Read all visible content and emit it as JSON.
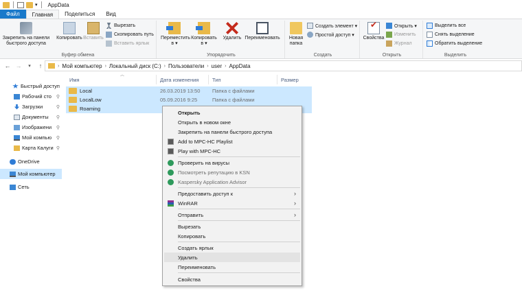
{
  "window": {
    "title": "AppData"
  },
  "tabs": [
    {
      "label": "Файл"
    },
    {
      "label": "Главная"
    },
    {
      "label": "Поделиться"
    },
    {
      "label": "Вид"
    }
  ],
  "ribbon": {
    "clipboard": {
      "pin_label_1": "Закрепить на панели",
      "pin_label_2": "быстрого доступа",
      "copy_label": "Копировать",
      "paste_label": "Вставить",
      "cut_label": "Вырезать",
      "copy_path_label": "Скопировать путь",
      "paste_link_label": "Вставить ярлык",
      "group_label": "Буфер обмена"
    },
    "organize": {
      "move_label": "Переместить",
      "copy_to_label": "Копировать",
      "delete_label": "Удалить",
      "rename_label": "Переименовать",
      "arrow": "в ▾",
      "group_label": "Упорядочить"
    },
    "new": {
      "new_folder_1": "Новая",
      "new_folder_2": "папка",
      "new_item_label": "Создать элемент ▾",
      "easy_access_label": "Простой доступ ▾",
      "group_label": "Создать"
    },
    "open": {
      "properties_label": "Свойства",
      "open_label": "Открыть ▾",
      "edit_label": "Изменить",
      "history_label": "Журнал",
      "group_label": "Открыть"
    },
    "select": {
      "select_all_label": "Выделить все",
      "select_none_label": "Снять выделение",
      "invert_label": "Обратить выделение",
      "group_label": "Выделить"
    }
  },
  "address": {
    "crumbs": [
      "Мой компьютер",
      "Локальный диск (C:)",
      "Пользователи",
      "user",
      "AppData"
    ]
  },
  "nav": {
    "items": [
      {
        "label": "Быстрый доступ",
        "icon": "star-icon"
      },
      {
        "label": "Рабочий сто",
        "icon": "desktop-icon"
      },
      {
        "label": "Загрузки",
        "icon": "download-icon"
      },
      {
        "label": "Документы",
        "icon": "documents-icon"
      },
      {
        "label": "Изображени",
        "icon": "pictures-icon"
      },
      {
        "label": "Мой компью",
        "icon": "computer-icon"
      },
      {
        "label": "Карта Калуги",
        "icon": "folder-icon"
      },
      {
        "label": "OneDrive",
        "icon": "cloud-icon"
      },
      {
        "label": "Мой компьютер",
        "icon": "computer-icon"
      },
      {
        "label": "Сеть",
        "icon": "network-icon"
      }
    ],
    "pin_glyph": "📌"
  },
  "columns": {
    "name": "Имя",
    "date": "Дата изменения",
    "type": "Тип",
    "size": "Размер"
  },
  "files": [
    {
      "name": "Local",
      "date": "26.03.2019 13:50",
      "type": "Папка с файлами"
    },
    {
      "name": "LocalLow",
      "date": "05.09.2016 9:25",
      "type": "Папка с файлами"
    },
    {
      "name": "Roaming",
      "date": "",
      "type": ""
    }
  ],
  "context_menu": {
    "open": "Открыть",
    "open_new_window": "Открыть в новом окне",
    "pin_quick": "Закрепить на панели быстрого доступа",
    "mpc_add": "Add to MPC-HC Playlist",
    "mpc_play": "Play with MPC-HC",
    "kas_scan": "Проверить на вирусы",
    "kas_rep": "Посмотреть репутацию в KSN",
    "kas_advisor": "Kaspersky Application Advisor",
    "share": "Предоставить доступ к",
    "winrar": "WinRAR",
    "send_to": "Отправить",
    "cut": "Вырезать",
    "copy": "Копировать",
    "create_shortcut": "Создать ярлык",
    "delete": "Удалить",
    "rename": "Переименовать",
    "properties": "Свойства",
    "submenu_arrow": "›"
  }
}
